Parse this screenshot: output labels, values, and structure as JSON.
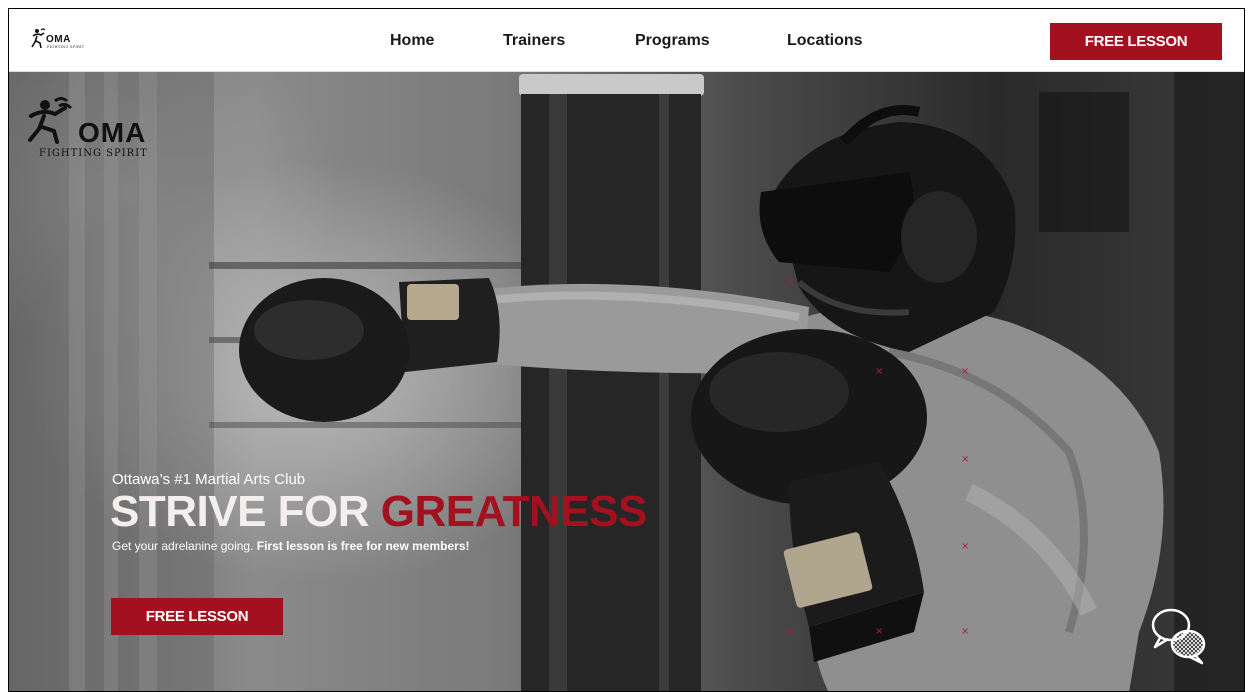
{
  "nav": {
    "logo": {
      "word": "OMA",
      "tagline": "FIGHTING SPIRIT"
    },
    "links": [
      {
        "label": "Home"
      },
      {
        "label": "Trainers"
      },
      {
        "label": "Programs"
      },
      {
        "label": "Locations"
      }
    ],
    "cta_label": "FREE LESSON"
  },
  "hero": {
    "logo": {
      "word": "OMA",
      "tagline": "FIGHTING SPIRIT"
    },
    "eyebrow": "Ottawa’s #1 Martial Arts Club",
    "title_light": "STRIVE FOR ",
    "title_accent": "GREATNESS",
    "subtitle_plain": "Get your adrelanine going. ",
    "subtitle_bold": "First lesson is free for new members!",
    "cta_label": "FREE LESSON"
  },
  "chat": {
    "icon": "chat-bubbles-icon"
  },
  "colors": {
    "brand_red": "#a3101f",
    "nav_bg": "#ffffff",
    "nav_text": "#1a1a1a",
    "hero_title_light": "#f4eeee"
  }
}
